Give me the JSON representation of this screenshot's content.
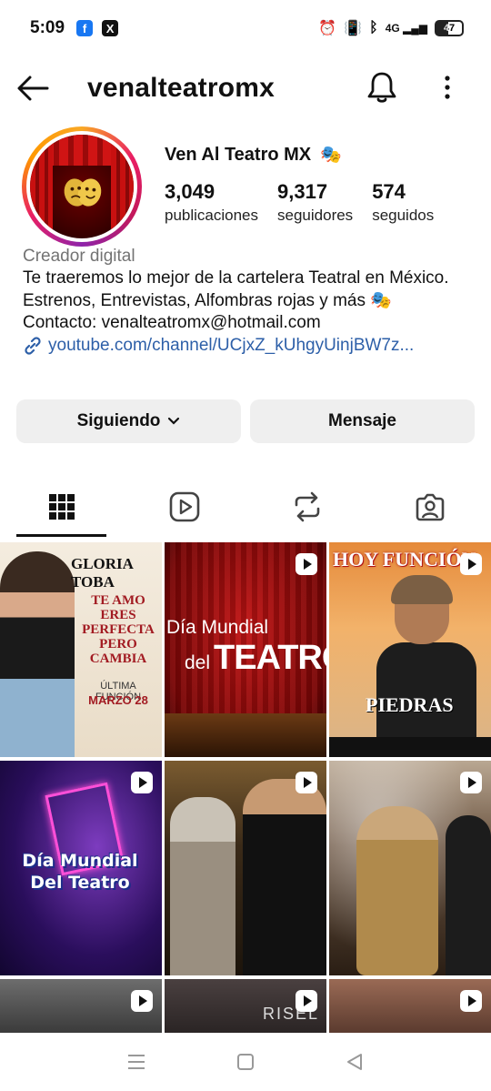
{
  "status_bar": {
    "time": "5:09",
    "battery": "47",
    "network": "4G"
  },
  "header": {
    "username": "venalteatromx"
  },
  "profile": {
    "display_name": "Ven Al Teatro MX",
    "name_emoji": "🎭",
    "stats": [
      {
        "value": "3,049",
        "label": "publicaciones"
      },
      {
        "value": "9,317",
        "label": "seguidores"
      },
      {
        "value": "574",
        "label": "seguidos"
      }
    ],
    "category": "Creador digital",
    "bio_lines": [
      "Te traeremos lo mejor de la cartelera Teatral en México.",
      "Estrenos, Entrevistas, Alfombras rojas y más 🎭",
      "Contacto: venalteatromx@hotmail.com"
    ],
    "link": "youtube.com/channel/UCjxZ_kUhgyUinjBW7z..."
  },
  "actions": {
    "following_label": "Siguiendo",
    "message_label": "Mensaje"
  },
  "posts": [
    {
      "id": "p1",
      "title": "GLORIA TOBA",
      "subtitle": "TE AMO ERES PERFECTA PERO CAMBIA",
      "line1": "ÚLTIMA FUNCIÓN",
      "line2": "MARZO 28",
      "is_reel": false
    },
    {
      "id": "p2",
      "line1": "Día Mundial",
      "line2": "del",
      "line3": "TEATRO",
      "is_reel": true
    },
    {
      "id": "p3",
      "banner": "HOY FUNCIÓN",
      "title": "PIEDRAS",
      "is_reel": true
    },
    {
      "id": "p4",
      "line1": "Día Mundial",
      "line2": "Del Teatro",
      "is_reel": true
    },
    {
      "id": "p5",
      "is_reel": true
    },
    {
      "id": "p6",
      "is_reel": true
    },
    {
      "id": "p7",
      "is_reel": true
    },
    {
      "id": "p8",
      "word": "RISEL",
      "is_reel": true
    },
    {
      "id": "p9",
      "is_reel": true
    }
  ],
  "colors": {
    "link": "#2d5fa8",
    "button_bg": "#efefef",
    "muted_text": "#737373"
  }
}
